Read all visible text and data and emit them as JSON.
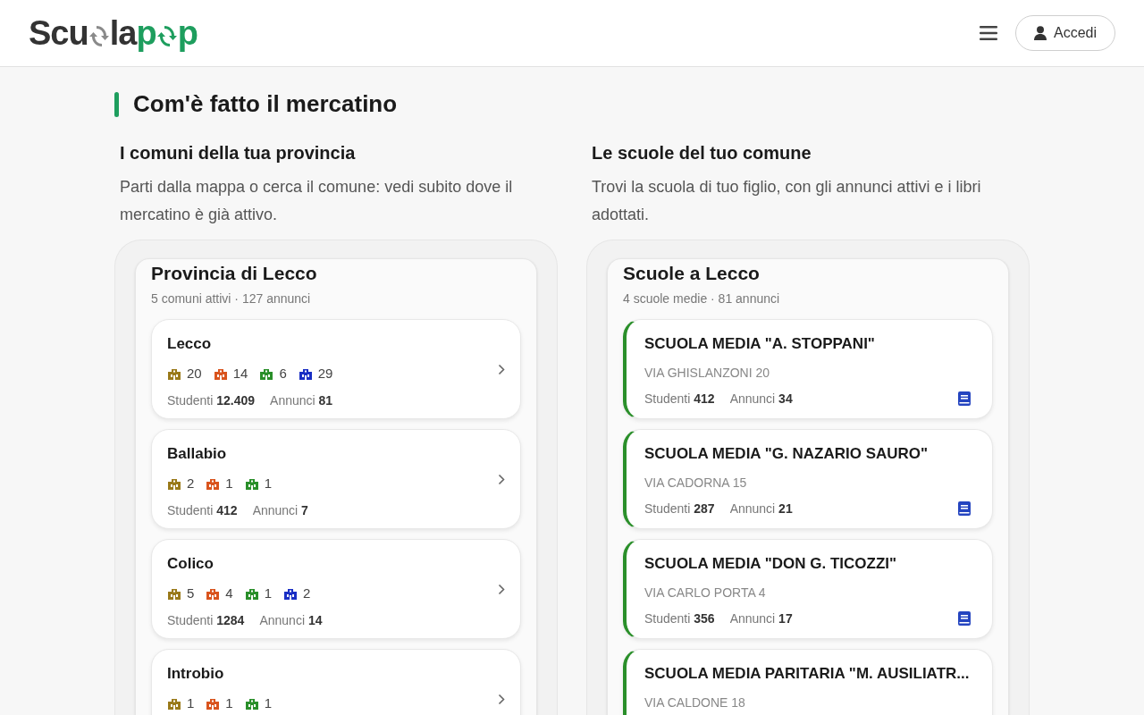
{
  "header": {
    "logo": {
      "parts": [
        {
          "kind": "text",
          "text": "Scu",
          "color": "#333333"
        },
        {
          "kind": "recycle",
          "color": "#8a8a8a"
        },
        {
          "kind": "text",
          "text": "la",
          "color": "#333333"
        },
        {
          "kind": "text",
          "text": "p",
          "color": "#1e9e5e"
        },
        {
          "kind": "recycle",
          "color": "#1e9e5e"
        },
        {
          "kind": "text",
          "text": "p",
          "color": "#1e9e5e"
        }
      ]
    },
    "login_button": "Accedi"
  },
  "section_title": "Com'è fatto il mercatino",
  "columns": [
    {
      "heading": "I comuni della tua provincia",
      "description": "Parti dalla mappa o cerca il comune: vedi subito dove il mercatino è già attivo.",
      "panel": {
        "title": "Provincia di Lecco",
        "subtitle": "5 comuni attivi · 127 annunci",
        "kind": "towns",
        "items": [
          {
            "name": "Lecco",
            "counts": [
              {
                "color": "#9a7a1a",
                "value": "20"
              },
              {
                "color": "#d9541e",
                "value": "14"
              },
              {
                "color": "#2a8f2a",
                "value": "6"
              },
              {
                "color": "#1a2fc4",
                "value": "29"
              }
            ],
            "students_label": "Studenti",
            "students": "12.409",
            "ads_label": "Annunci",
            "ads": "81"
          },
          {
            "name": "Ballabio",
            "counts": [
              {
                "color": "#9a7a1a",
                "value": "2"
              },
              {
                "color": "#d9541e",
                "value": "1"
              },
              {
                "color": "#2a8f2a",
                "value": "1"
              }
            ],
            "students_label": "Studenti",
            "students": "412",
            "ads_label": "Annunci",
            "ads": "7"
          },
          {
            "name": "Colico",
            "counts": [
              {
                "color": "#9a7a1a",
                "value": "5"
              },
              {
                "color": "#d9541e",
                "value": "4"
              },
              {
                "color": "#2a8f2a",
                "value": "1"
              },
              {
                "color": "#1a2fc4",
                "value": "2"
              }
            ],
            "students_label": "Studenti",
            "students": "1284",
            "ads_label": "Annunci",
            "ads": "14"
          },
          {
            "name": "Introbio",
            "counts": [
              {
                "color": "#9a7a1a",
                "value": "1"
              },
              {
                "color": "#d9541e",
                "value": "1"
              },
              {
                "color": "#2a8f2a",
                "value": "1"
              }
            ]
          }
        ]
      }
    },
    {
      "heading": "Le scuole del tuo comune",
      "description": "Trovi la scuola di tuo figlio, con gli annunci attivi e i libri adottati.",
      "panel": {
        "title": "Scuole a Lecco",
        "subtitle": "4 scuole medie · 81 annunci",
        "kind": "schools",
        "items": [
          {
            "name": "SCUOLA MEDIA \"A. STOPPANI\"",
            "address": "VIA GHISLANZONI 20",
            "students_label": "Studenti",
            "students": "412",
            "ads_label": "Annunci",
            "ads": "34"
          },
          {
            "name": "SCUOLA MEDIA \"G. NAZARIO SAURO\"",
            "address": "VIA CADORNA 15",
            "students_label": "Studenti",
            "students": "287",
            "ads_label": "Annunci",
            "ads": "21"
          },
          {
            "name": "SCUOLA MEDIA \"DON G. TICOZZI\"",
            "address": "VIA CARLO PORTA 4",
            "students_label": "Studenti",
            "students": "356",
            "ads_label": "Annunci",
            "ads": "17"
          },
          {
            "name": "SCUOLA MEDIA PARITARIA \"M. AUSILIATR...",
            "address": "VIA CALDONE 18"
          }
        ]
      }
    }
  ]
}
